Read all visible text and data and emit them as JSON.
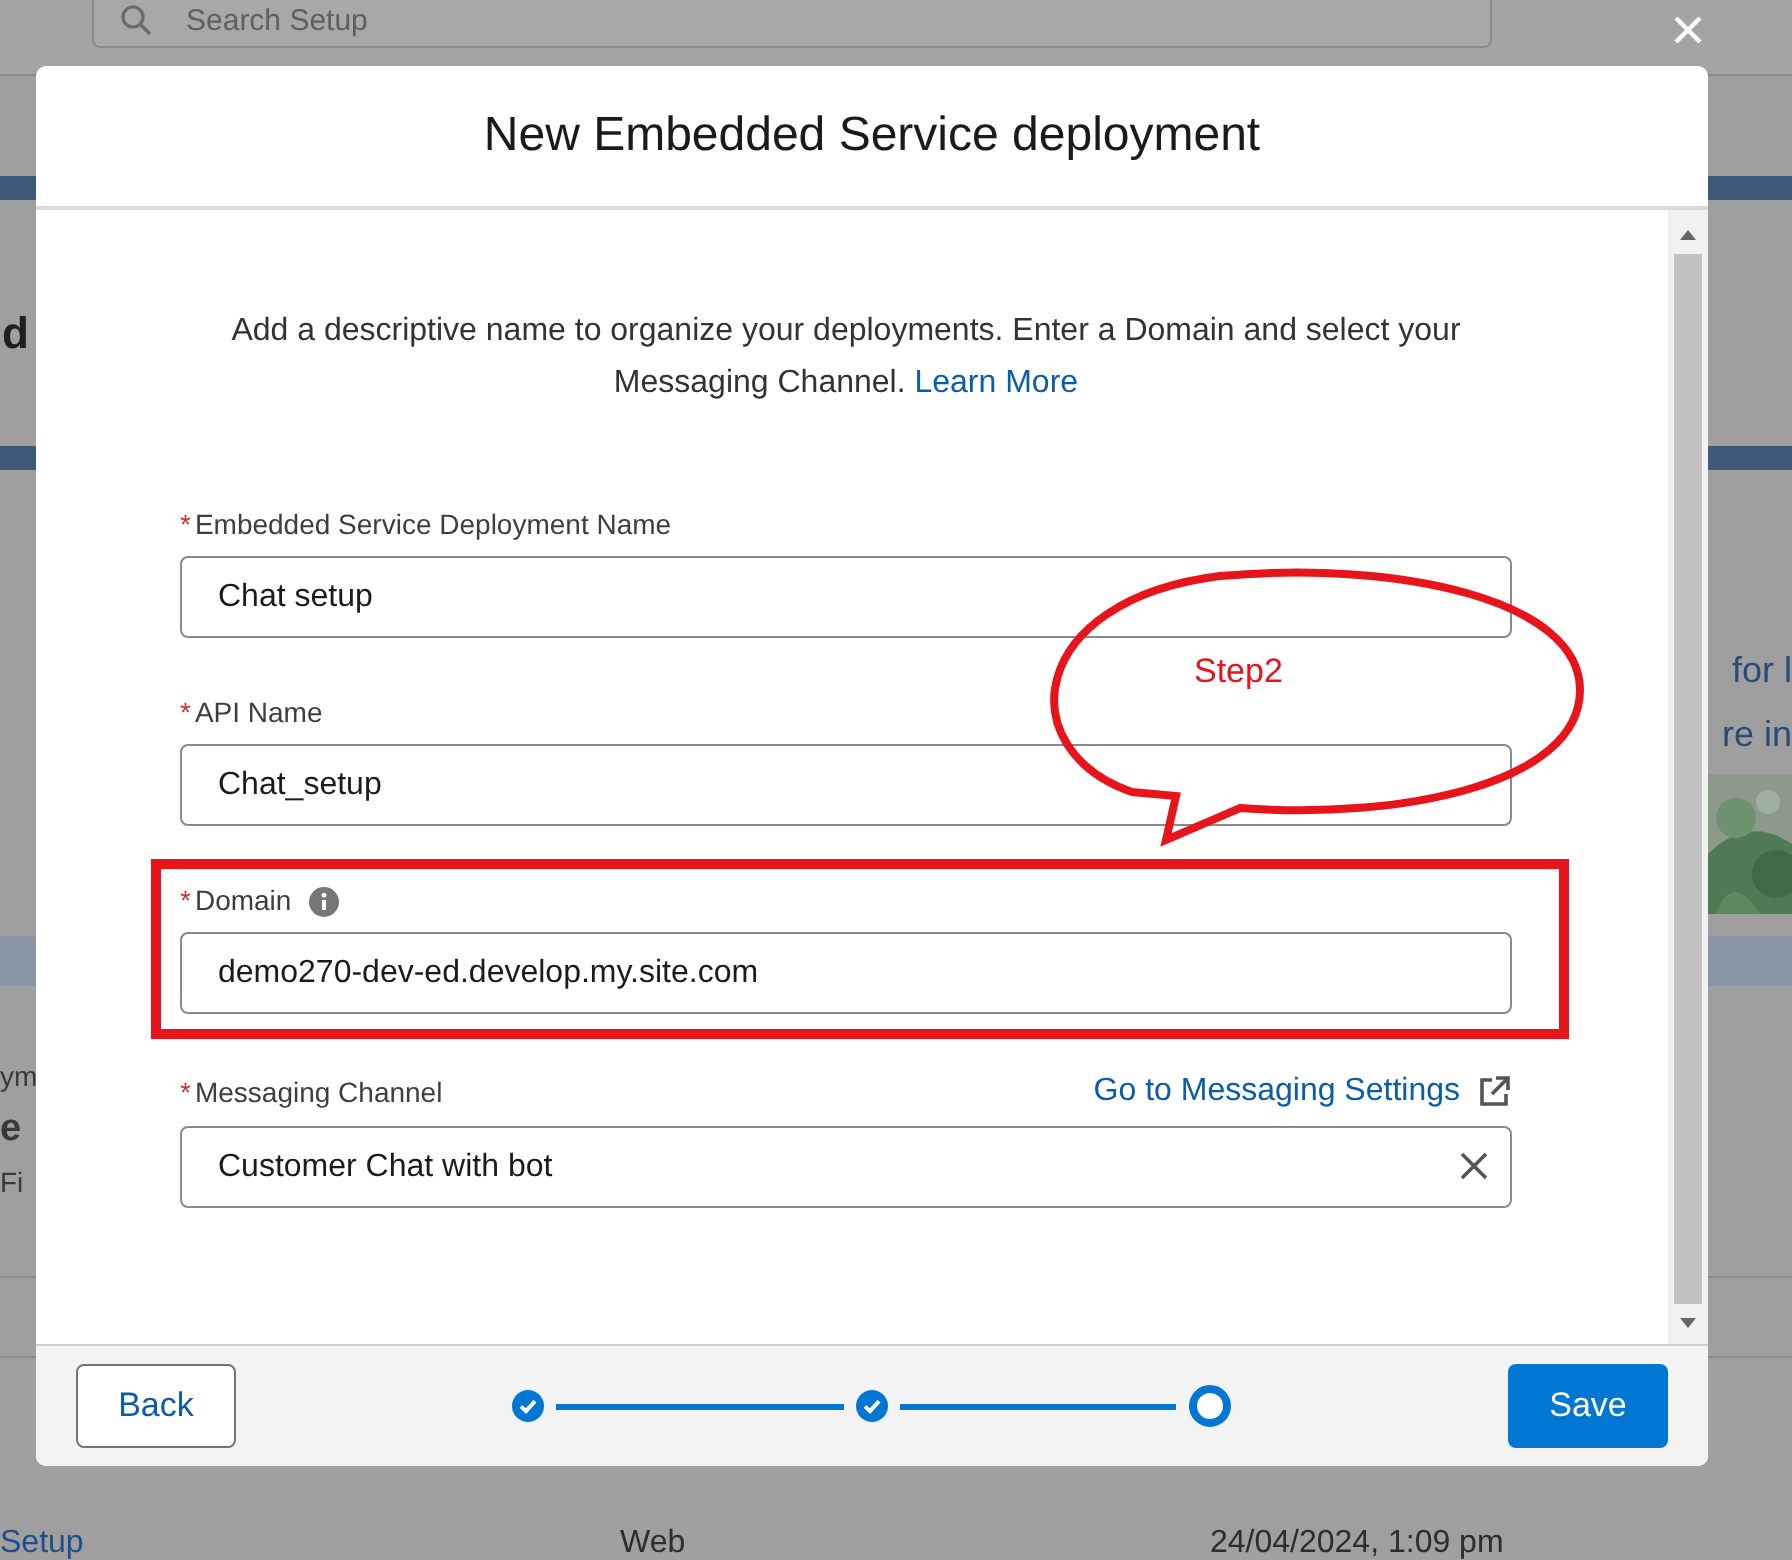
{
  "background": {
    "search_placeholder": "Search Setup",
    "heading_fragment": "d",
    "side_fragments": [
      "for l",
      "re in"
    ],
    "left_fragments": [
      "ym",
      "e",
      "Fi"
    ],
    "row": [
      "Setup",
      "Web",
      "24/04/2024, 1:09 pm"
    ]
  },
  "modal": {
    "title": "New Embedded Service deployment",
    "intro": "Add a descriptive name to organize your deployments. Enter a Domain and select your Messaging Channel.",
    "intro_link": "Learn More"
  },
  "fields": [
    {
      "kind": "text",
      "required_mark": "*",
      "label": "Embedded Service Deployment Name",
      "value": "Chat setup"
    },
    {
      "kind": "text",
      "required_mark": "*",
      "label": "API Name",
      "value": "Chat_setup"
    },
    {
      "kind": "text",
      "required_mark": "*",
      "label": "Domain",
      "info_icon": true,
      "value": "demo270-dev-ed.develop.my.site.com"
    },
    {
      "kind": "lookup",
      "required_mark": "*",
      "label": "Messaging Channel",
      "link": "Go to Messaging Settings",
      "value": "Customer Chat with bot"
    }
  ],
  "steps": [
    {
      "completed": true
    },
    {
      "completed": true
    },
    {
      "completed": false
    }
  ],
  "buttons": {
    "back": "Back",
    "save": "Save"
  },
  "annotation": {
    "callout": "Step2"
  }
}
